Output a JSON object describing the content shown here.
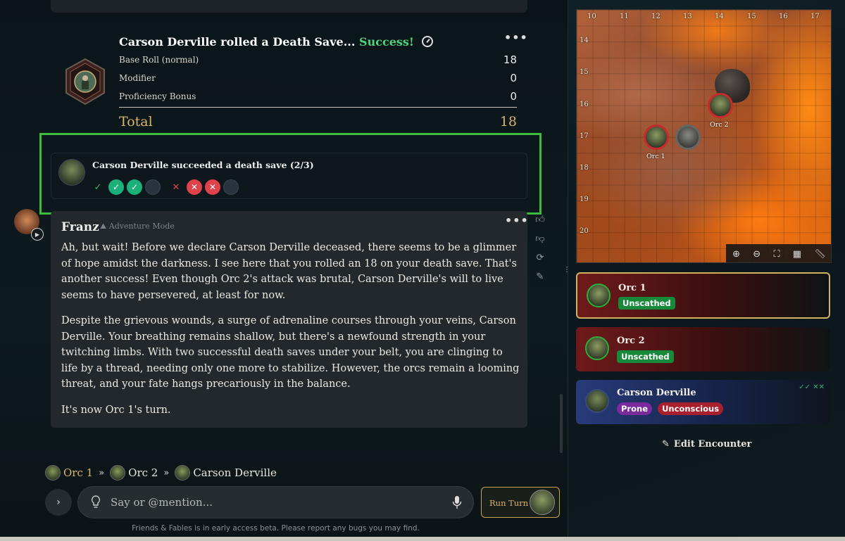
{
  "roll": {
    "title_prefix": "Carson Derville rolled a Death Save...",
    "title_result": "Success!",
    "rows": [
      {
        "label": "Base Roll (normal)",
        "value": "18"
      },
      {
        "label": "Modifier",
        "value": "0"
      },
      {
        "label": "Proficiency Bonus",
        "value": "0"
      }
    ],
    "total_label": "Total",
    "total_value": "18"
  },
  "death_save": {
    "text": "Carson Derville succeeded a death save (2/3)",
    "successes": 2,
    "failures": 2,
    "max": 3,
    "success_icon": "✓",
    "failure_icon": "✕"
  },
  "message": {
    "author": "Franz",
    "mode": "Adventure Mode",
    "paragraphs": [
      "Ah, but wait! Before we declare Carson Derville deceased, there seems to be a glimmer of hope amidst the darkness. I see here that you rolled an 18 on your death save. That's another success! Even though Orc 2's attack was brutal, Carson Derville's will to live seems to have persevered, at least for now.",
      "Despite the grievous wounds, a surge of adrenaline courses through your veins, Carson Derville. Your breathing remains shallow, but there's a newfound strength in your twitching limbs. With two successful death saves under your belt, you are clinging to life by a thread, needing only one more to stabilize. However, the orcs remain a looming threat, and your fate hangs precariously in the balance.",
      "It's now Orc 1's turn."
    ],
    "more": "•••"
  },
  "turn_order": [
    {
      "name": "Orc 1",
      "current": true
    },
    {
      "name": "Orc 2",
      "current": false
    },
    {
      "name": "Carson Derville",
      "current": false
    }
  ],
  "turn_separator": "»",
  "composer": {
    "placeholder": "Say or @mention...",
    "run_turn": "Run Turn",
    "expand": "›"
  },
  "footer": "Friends & Fables is in early access beta. Please report any bugs you may find.",
  "map": {
    "col_labels": [
      "10",
      "11",
      "12",
      "13",
      "14",
      "15",
      "16",
      "17"
    ],
    "row_labels": [
      "14",
      "15",
      "16",
      "17",
      "18",
      "19",
      "20"
    ],
    "tokens": [
      {
        "name": "Orc 1"
      },
      {
        "name": "Orc 2"
      }
    ],
    "tools": [
      "zoom-in-icon",
      "zoom-out-icon",
      "fit-icon",
      "grid-icon",
      "ruler-icon"
    ]
  },
  "combatants": [
    {
      "name": "Orc 1",
      "badges": [
        "Unscathed"
      ],
      "active": true
    },
    {
      "name": "Orc 2",
      "badges": [
        "Unscathed"
      ],
      "active": false
    },
    {
      "name": "Carson Derville",
      "badges": [
        "Prone",
        "Unconscious"
      ],
      "death_saves": "✓✓ ✕✕"
    }
  ],
  "edit_encounter": "Edit Encounter",
  "colors": {
    "success": "#4fd17a",
    "gold": "#d9b46a",
    "highlight": "#3dbb3f",
    "orc_card": "#6f1a1a",
    "pc_card": "#283b7a"
  }
}
